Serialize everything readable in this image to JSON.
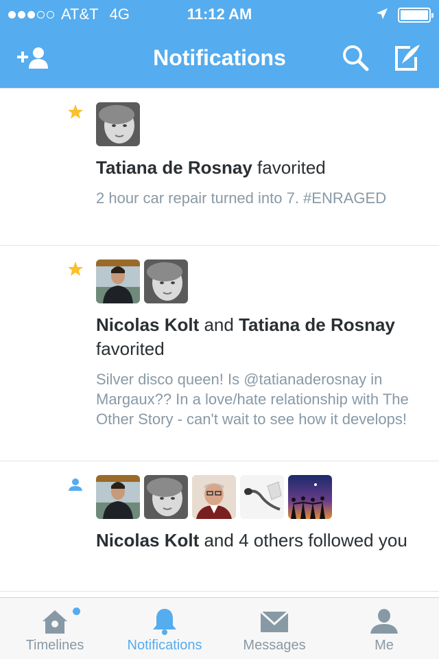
{
  "status_bar": {
    "carrier": "AT&T",
    "network": "4G",
    "time": "11:12 AM",
    "signal_bars_filled": 3,
    "signal_bars_total": 5
  },
  "header": {
    "title": "Notifications",
    "left_icon": "add-user-icon",
    "right_icons": [
      "search-icon",
      "compose-icon"
    ]
  },
  "notifications": [
    {
      "type": "favorite",
      "icon": "star-icon",
      "name1": "Tatiana de Rosnay",
      "action": " favorited",
      "tweet": "2 hour car repair turned into 7. #ENRAGED"
    },
    {
      "type": "favorite",
      "icon": "star-icon",
      "name1": "Nicolas Kolt",
      "joiner": " and ",
      "name2": "Tatiana de Rosnay",
      "action": " favorited",
      "tweet": "Silver disco queen! Is @tatianaderosnay in Margaux?? In a love/hate relationship with The Other Story - can't wait to see how it develops!"
    },
    {
      "type": "follow",
      "icon": "person-icon",
      "name1": "Nicolas Kolt",
      "action": " and 4 others followed you"
    }
  ],
  "tabs": [
    {
      "label": "Timelines",
      "icon": "home-icon"
    },
    {
      "label": "Notifications",
      "icon": "bell-icon"
    },
    {
      "label": "Messages",
      "icon": "envelope-icon"
    },
    {
      "label": "Me",
      "icon": "person-icon"
    }
  ],
  "colors": {
    "brand": "#55acee",
    "star": "#fbc02d",
    "text": "#292f33",
    "muted": "#8899a6"
  }
}
